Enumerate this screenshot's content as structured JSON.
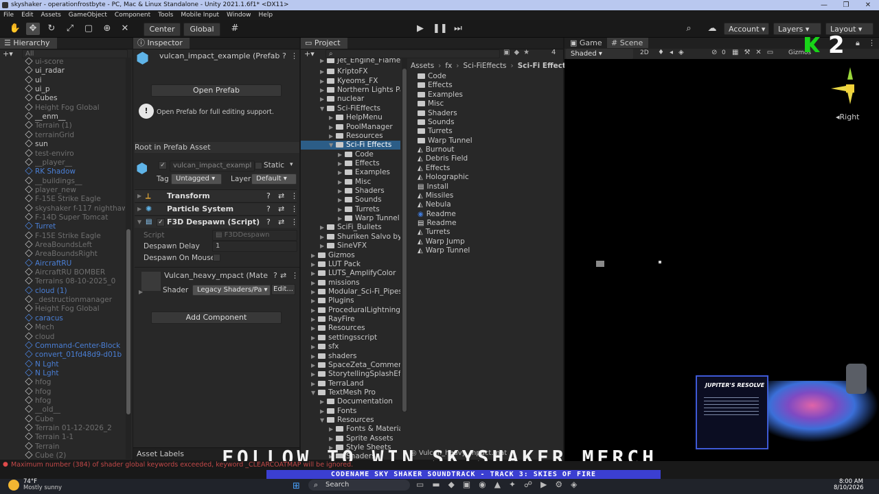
{
  "window": {
    "title": "skyshaker - operationfrostbyte - PC, Mac & Linux Standalone - Unity 2021.1.6f1* <DX11>",
    "controls": [
      "—",
      "❐",
      "□",
      "✕"
    ]
  },
  "menu": [
    "File",
    "Edit",
    "Assets",
    "GameObject",
    "Component",
    "Tools",
    "Mobile Input",
    "Window",
    "Help"
  ],
  "toolbar": {
    "pivot": "Center",
    "space": "Global",
    "account": "Account",
    "layers": "Layers",
    "layout": "Layout"
  },
  "hierarchy": {
    "tab": "Hierarchy",
    "search_placeholder": "All",
    "items": [
      {
        "label": "ui-score",
        "style": "dim"
      },
      {
        "label": "ui_radar",
        "style": "normal"
      },
      {
        "label": "ui",
        "style": "normal"
      },
      {
        "label": "ui_p",
        "style": "normal"
      },
      {
        "label": "Cubes",
        "style": "normal"
      },
      {
        "label": "Height Fog Global",
        "style": "dim"
      },
      {
        "label": "__enm__",
        "style": "normal"
      },
      {
        "label": "Terrain (1)",
        "style": "dim"
      },
      {
        "label": "terrainGrid",
        "style": "dim"
      },
      {
        "label": "sun",
        "style": "normal"
      },
      {
        "label": "test-enviro",
        "style": "dim"
      },
      {
        "label": "__player__",
        "style": "dim"
      },
      {
        "label": "RK Shadow",
        "style": "blue"
      },
      {
        "label": "__buildings__",
        "style": "dim"
      },
      {
        "label": "player_new",
        "style": "dim"
      },
      {
        "label": "F-15E Strike Eagle",
        "style": "dim"
      },
      {
        "label": "skyshaker f-117 nighthawk",
        "style": "dim"
      },
      {
        "label": "F-14D Super Tomcat",
        "style": "dim"
      },
      {
        "label": "Turret",
        "style": "blue"
      },
      {
        "label": "F-15E Strike Eagle",
        "style": "dim"
      },
      {
        "label": "AreaBoundsLeft",
        "style": "dim"
      },
      {
        "label": "AreaBoundsRight",
        "style": "dim"
      },
      {
        "label": "AircraftRU",
        "style": "blue"
      },
      {
        "label": "AircraftRU BOMBER",
        "style": "dim"
      },
      {
        "label": "Terrains 08-10-2025_0",
        "style": "dim"
      },
      {
        "label": "cloud (1)",
        "style": "blue"
      },
      {
        "label": "_destructionmanager",
        "style": "dim"
      },
      {
        "label": "Height Fog Global",
        "style": "dim"
      },
      {
        "label": "caracus",
        "style": "blue"
      },
      {
        "label": "Mech",
        "style": "dim"
      },
      {
        "label": "cloud",
        "style": "dim"
      },
      {
        "label": "Command-Center-Block",
        "style": "blue"
      },
      {
        "label": "convert_01fd48d9-d01b",
        "style": "blue"
      },
      {
        "label": "N Lght",
        "style": "blue"
      },
      {
        "label": "N Lght",
        "style": "blue"
      },
      {
        "label": "hfog",
        "style": "dim"
      },
      {
        "label": "hfog",
        "style": "dim"
      },
      {
        "label": "hfog",
        "style": "dim"
      },
      {
        "label": "__old__",
        "style": "dim"
      },
      {
        "label": "Cube",
        "style": "dim"
      },
      {
        "label": "Terrain 01-12-2026_2",
        "style": "dim"
      },
      {
        "label": "Terrain 1-1",
        "style": "dim"
      },
      {
        "label": "Terrain",
        "style": "dim"
      },
      {
        "label": "Cube (2)",
        "style": "dim"
      }
    ]
  },
  "inspector": {
    "tab": "Inspector",
    "object_name": "vulcan_impact_example (Prefab A",
    "open_prefab": "Open Prefab",
    "info": "Open Prefab for full editing support.",
    "root_label": "Root in Prefab Asset",
    "name_field": "vulcan_impact_exampl",
    "static_label": "Static",
    "tag_label": "Tag",
    "tag_value": "Untagged",
    "layer_label": "Layer",
    "layer_value": "Default",
    "components": [
      "Transform",
      "Particle System",
      "F3D Despawn (Script)"
    ],
    "script_label": "Script",
    "script_value": "F3DDespawn",
    "delay_label": "Despawn Delay",
    "delay_value": "1",
    "mouse_label": "Despawn On Mouse",
    "material_name": "Vulcan_heavy_mpact (Materi",
    "shader_label": "Shader",
    "shader_value": "Legacy Shaders/Pa",
    "edit_label": "Edit...",
    "add_component": "Add Component",
    "asset_labels": "Asset Labels"
  },
  "project": {
    "tab": "Project",
    "count": "4",
    "tree": [
      {
        "label": "Jet_Engine_Flames",
        "indent": 2,
        "cut": true
      },
      {
        "label": "KriptoFX",
        "indent": 2
      },
      {
        "label": "Kyeoms_FX",
        "indent": 2
      },
      {
        "label": "Northern Lights Pac",
        "indent": 2
      },
      {
        "label": "nuclear",
        "indent": 2
      },
      {
        "label": "Sci-FiEffects",
        "indent": 2,
        "open": true
      },
      {
        "label": "HelpMenu",
        "indent": 3
      },
      {
        "label": "PoolManager",
        "indent": 3
      },
      {
        "label": "Resources",
        "indent": 3
      },
      {
        "label": "Sci-Fi Effects",
        "indent": 3,
        "selected": true,
        "open": true
      },
      {
        "label": "Code",
        "indent": 4
      },
      {
        "label": "Effects",
        "indent": 4
      },
      {
        "label": "Examples",
        "indent": 4
      },
      {
        "label": "Misc",
        "indent": 4
      },
      {
        "label": "Shaders",
        "indent": 4
      },
      {
        "label": "Sounds",
        "indent": 4
      },
      {
        "label": "Turrets",
        "indent": 4
      },
      {
        "label": "Warp Tunnel",
        "indent": 4
      },
      {
        "label": "SciFi_Bullets",
        "indent": 2
      },
      {
        "label": "Shuriken Salvo by N",
        "indent": 2
      },
      {
        "label": "SineVFX",
        "indent": 2
      },
      {
        "label": "Gizmos",
        "indent": 1
      },
      {
        "label": "LUT Pack",
        "indent": 1
      },
      {
        "label": "LUTS_AmplifyColor",
        "indent": 1
      },
      {
        "label": "missions",
        "indent": 1
      },
      {
        "label": "Modular_Sci-Fi_Pipes",
        "indent": 1
      },
      {
        "label": "Plugins",
        "indent": 1
      },
      {
        "label": "ProceduralLightning",
        "indent": 1
      },
      {
        "label": "RayFire",
        "indent": 1
      },
      {
        "label": "Resources",
        "indent": 1
      },
      {
        "label": "settingsscript",
        "indent": 1
      },
      {
        "label": "sfx",
        "indent": 1
      },
      {
        "label": "shaders",
        "indent": 1
      },
      {
        "label": "SpaceZeta_Commerci",
        "indent": 1
      },
      {
        "label": "StorytellingSplashEffe",
        "indent": 1
      },
      {
        "label": "TerraLand",
        "indent": 1
      },
      {
        "label": "TextMesh Pro",
        "indent": 1,
        "open": true
      },
      {
        "label": "Documentation",
        "indent": 2
      },
      {
        "label": "Fonts",
        "indent": 2
      },
      {
        "label": "Resources",
        "indent": 2,
        "open": true
      },
      {
        "label": "Fonts & Materials",
        "indent": 3
      },
      {
        "label": "Sprite Assets",
        "indent": 3
      },
      {
        "label": "Style Sheets",
        "indent": 3
      },
      {
        "label": "Shaders",
        "indent": 3
      }
    ],
    "breadcrumb": [
      "Assets",
      "fx",
      "Sci-FiEffects",
      "Sci-Fi Effects"
    ],
    "files": [
      {
        "label": "Code",
        "kind": "folder"
      },
      {
        "label": "Effects",
        "kind": "folder"
      },
      {
        "label": "Examples",
        "kind": "folder"
      },
      {
        "label": "Misc",
        "kind": "folder"
      },
      {
        "label": "Shaders",
        "kind": "folder"
      },
      {
        "label": "Sounds",
        "kind": "folder"
      },
      {
        "label": "Turrets",
        "kind": "folder"
      },
      {
        "label": "Warp Tunnel",
        "kind": "folder"
      },
      {
        "label": "Burnout",
        "kind": "unity"
      },
      {
        "label": "Debris Field",
        "kind": "unity"
      },
      {
        "label": "Effects",
        "kind": "unity"
      },
      {
        "label": "Holographic",
        "kind": "unity"
      },
      {
        "label": "Install",
        "kind": "doc"
      },
      {
        "label": "Missiles",
        "kind": "unity"
      },
      {
        "label": "Nebula",
        "kind": "unity"
      },
      {
        "label": "Readme",
        "kind": "readme"
      },
      {
        "label": "Readme",
        "kind": "doc"
      },
      {
        "label": "Turrets",
        "kind": "unity"
      },
      {
        "label": "Warp Jump",
        "kind": "unity"
      },
      {
        "label": "Warp Tunnel",
        "kind": "unity"
      }
    ],
    "bottom_asset": "Vulcan_heavy_mpact.mat"
  },
  "scene": {
    "tab_game": "Game",
    "tab_scene": "Scene",
    "shading": "Shaded",
    "mode_2d": "2D",
    "hidden_count": "0",
    "gizmos": "Gizmos",
    "view_label": "Right",
    "stream_number": "2",
    "card_title": "JUPITER'S RESOLVE"
  },
  "overlay": {
    "headline": "FOLLOW TO WIN SKYSHAKER MERCH",
    "ticker": "CODENAME SKY SHAKER SOUNDTRACK - TRACK 3: SKIES OF FIRE",
    "console_error": "Maximum number (384) of shader global keywords exceeded, keyword _CLEARCOATMAP will be ignored."
  },
  "taskbar": {
    "temp": "74°F",
    "weather": "Mostly sunny",
    "search": "Search",
    "time": "8:00 AM",
    "date": "8/10/2026"
  },
  "colors": {
    "accent": "#2c5d87",
    "selected_tree": "#2c5d87",
    "ticker_bg": "#3b3fd1",
    "logo_green": "#18d418"
  }
}
